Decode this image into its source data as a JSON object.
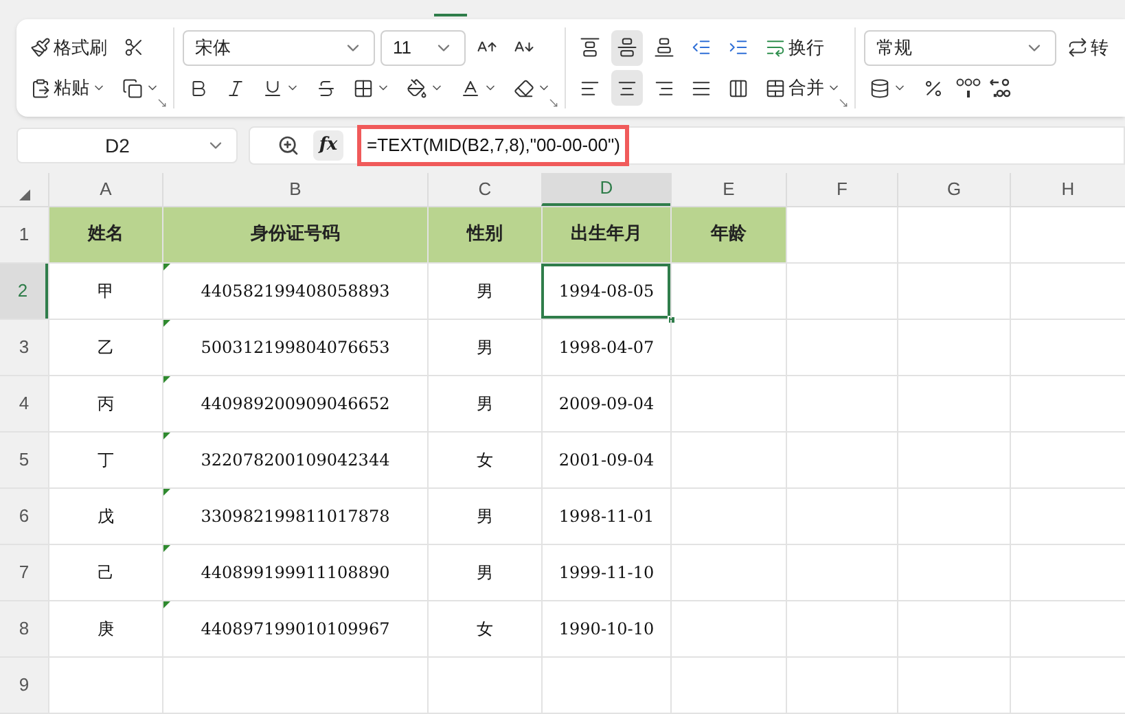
{
  "ribbon": {
    "groups": [
      {
        "launcher": true,
        "rows": [
          [
            {
              "kind": "painter",
              "label": "格式刷"
            },
            {
              "kind": "scissors"
            }
          ],
          [
            {
              "kind": "paste",
              "label": "粘贴",
              "dropdown": true
            },
            {
              "kind": "copy",
              "dropdown": true
            }
          ]
        ]
      },
      {
        "launcher": true,
        "rows": [
          [
            {
              "kind": "select",
              "label": "宋体",
              "wide": true
            },
            {
              "kind": "select",
              "label": "11"
            },
            {
              "kind": "grow"
            },
            {
              "kind": "shrink"
            }
          ],
          [
            {
              "kind": "bold"
            },
            {
              "kind": "italic"
            },
            {
              "kind": "underline",
              "dropdown": true
            },
            {
              "kind": "strike"
            },
            {
              "kind": "border",
              "dropdown": true
            },
            {
              "kind": "fill",
              "dropdown": true
            },
            {
              "kind": "fontcolor",
              "dropdown": true
            },
            {
              "kind": "eraser",
              "dropdown": true
            }
          ]
        ]
      },
      {
        "launcher": true,
        "rows": [
          [
            {
              "kind": "top",
              "selected": false
            },
            {
              "kind": "middle",
              "selected": true
            },
            {
              "kind": "bottom",
              "selected": false
            },
            {
              "kind": "outdent",
              "selected": false
            },
            {
              "kind": "indent",
              "selected": false
            },
            {
              "kind": "wrap",
              "label": "换行"
            }
          ],
          [
            {
              "kind": "left",
              "selected": false
            },
            {
              "kind": "center",
              "selected": true
            },
            {
              "kind": "right",
              "selected": false
            },
            {
              "kind": "justify",
              "selected": false
            },
            {
              "kind": "distribute",
              "selected": false
            },
            {
              "kind": "merge",
              "label": "合并",
              "dropdown": true
            }
          ]
        ]
      },
      {
        "launcher": false,
        "rows": [
          [
            {
              "kind": "select",
              "label": "常规",
              "wide": true
            },
            {
              "kind": "convert",
              "label": "转"
            }
          ],
          [
            {
              "kind": "stack",
              "dropdown": true
            },
            {
              "kind": "percent"
            },
            {
              "kind": "comma"
            },
            {
              "kind": "decimal"
            }
          ]
        ]
      }
    ]
  },
  "name_box": "D2",
  "fx": "fx",
  "formula": "=TEXT(MID(B2,7,8),\"00-00-00\")",
  "columns": [
    {
      "label": "A",
      "selected": false
    },
    {
      "label": "B",
      "selected": false
    },
    {
      "label": "C",
      "selected": false
    },
    {
      "label": "D",
      "selected": true
    },
    {
      "label": "E",
      "selected": false
    },
    {
      "label": "F",
      "selected": false
    },
    {
      "label": "G",
      "selected": false
    },
    {
      "label": "H",
      "selected": false
    }
  ],
  "rows": [
    {
      "label": "1",
      "selected": false,
      "kind": "header",
      "flagged": false,
      "cells": [
        "姓名",
        "身份证号码",
        "性别",
        "出生年月",
        "年龄"
      ]
    },
    {
      "label": "2",
      "selected": true,
      "kind": "data",
      "flagged": true,
      "cells": [
        "甲",
        "440582199408058893",
        "男",
        "1994-08-05"
      ]
    },
    {
      "label": "3",
      "selected": false,
      "kind": "data",
      "flagged": true,
      "cells": [
        "乙",
        "500312199804076653",
        "男",
        "1998-04-07"
      ]
    },
    {
      "label": "4",
      "selected": false,
      "kind": "data",
      "flagged": true,
      "cells": [
        "丙",
        "440989200909046652",
        "男",
        "2009-09-04"
      ]
    },
    {
      "label": "5",
      "selected": false,
      "kind": "data",
      "flagged": true,
      "cells": [
        "丁",
        "322078200109042344",
        "女",
        "2001-09-04"
      ]
    },
    {
      "label": "6",
      "selected": false,
      "kind": "data",
      "flagged": true,
      "cells": [
        "戊",
        "330982199811017878",
        "男",
        "1998-11-01"
      ]
    },
    {
      "label": "7",
      "selected": false,
      "kind": "data",
      "flagged": true,
      "cells": [
        "己",
        "440899199911108890",
        "男",
        "1999-11-10"
      ]
    },
    {
      "label": "8",
      "selected": false,
      "kind": "data",
      "flagged": true,
      "cells": [
        "庚",
        "440897199010109967",
        "女",
        "1990-10-10"
      ]
    },
    {
      "label": "9",
      "selected": false,
      "kind": "data",
      "flagged": false,
      "cells": []
    }
  ]
}
